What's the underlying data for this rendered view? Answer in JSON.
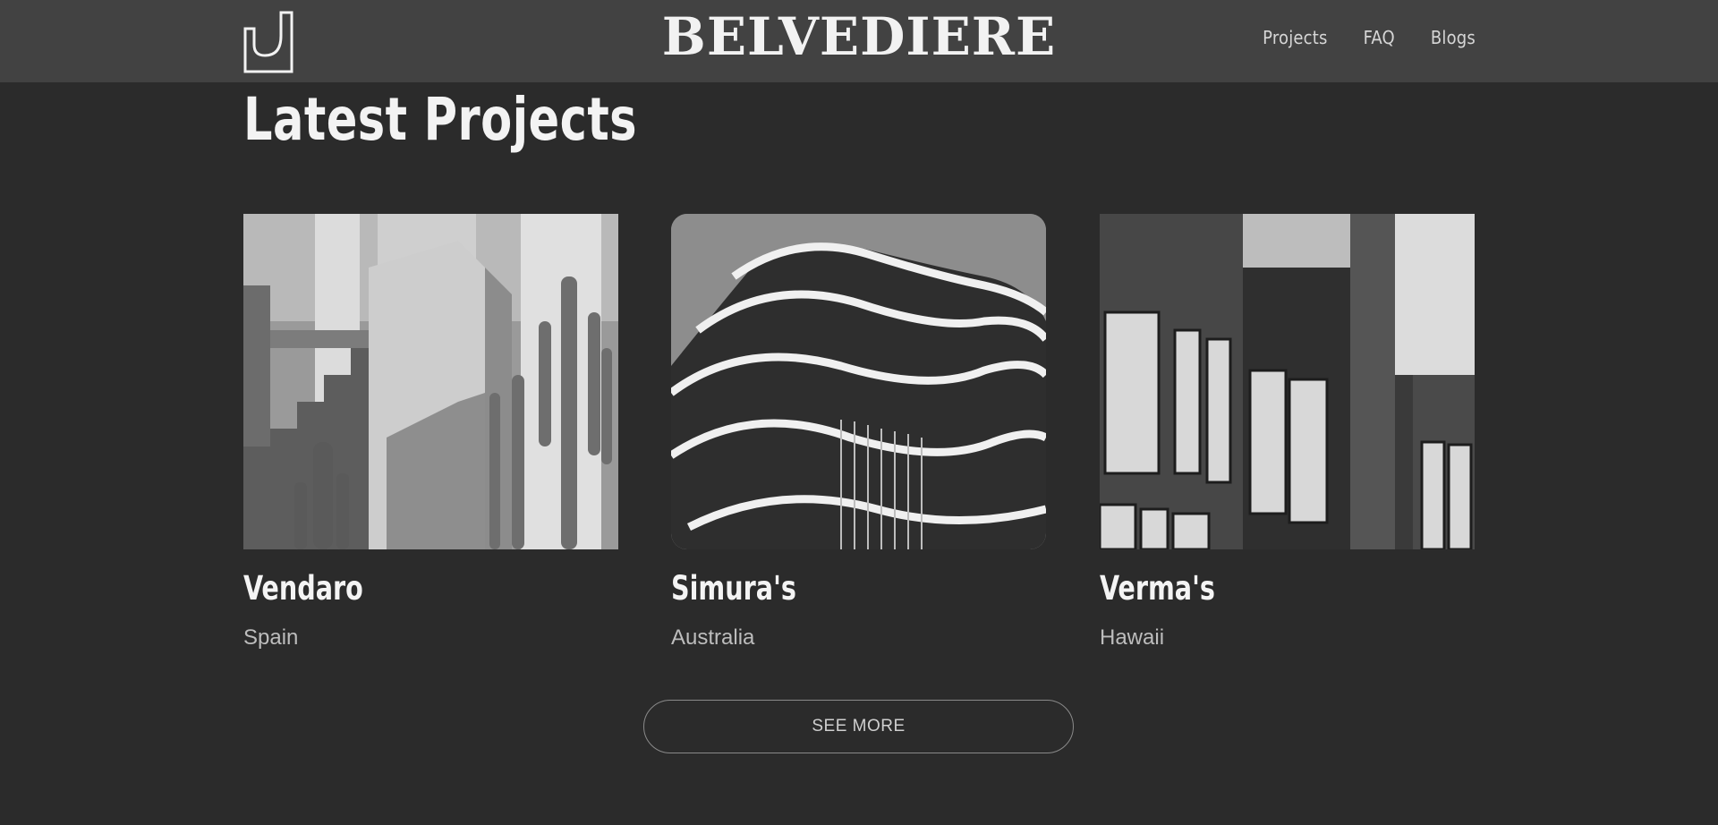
{
  "header": {
    "brand": "BELVEDIERE",
    "logo_icon": "bracket-logo-icon",
    "nav": [
      {
        "label": "Projects"
      },
      {
        "label": "FAQ"
      },
      {
        "label": "Blogs"
      }
    ]
  },
  "main": {
    "title": "Latest Projects",
    "projects": [
      {
        "name": "Vendaro",
        "location": "Spain",
        "image": "cactus-building-photo"
      },
      {
        "name": "Simura's",
        "location": "Australia",
        "image": "curved-balconies-photo"
      },
      {
        "name": "Verma's",
        "location": "Hawaii",
        "image": "glass-facade-photo"
      }
    ],
    "see_more_label": "SEE MORE"
  },
  "colors": {
    "background": "#2b2b2b",
    "header": "#424242",
    "text": "#f3f3f3",
    "muted": "#bdbdbd"
  }
}
